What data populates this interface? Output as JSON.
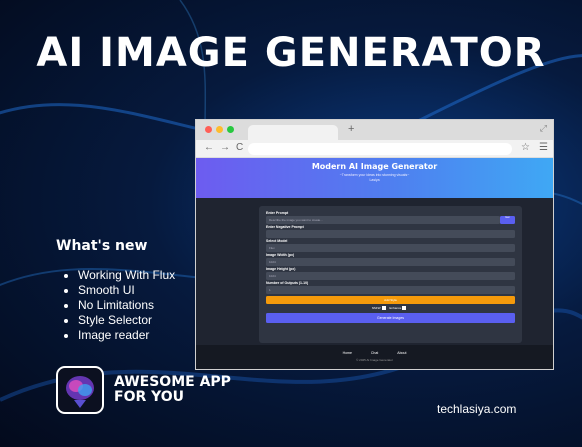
{
  "headline": "AI IMAGE GENERATOR",
  "whats_new": {
    "title": "What's new",
    "items": [
      "Working With Flux",
      "Smooth UI",
      "No Limitations",
      "Style Selector",
      "Image reader"
    ]
  },
  "app_badge": {
    "line1": "AWESOME APP",
    "line2": "FOR YOU"
  },
  "site": "techlasiya.com",
  "browser": {
    "plus": "+",
    "back": "←",
    "forward": "→",
    "reload": "C",
    "star": "☆",
    "menu": "☰",
    "page": {
      "title": "Modern AI Image Generator",
      "subtitle": "~Transform your ideas into stunning visuals~",
      "author": "Lasiya",
      "labels": {
        "prompt": "Enter Prompt",
        "negative": "Enter Negative Prompt",
        "model": "Select Model",
        "width": "Image Width (px)",
        "height": "Image Height (px)",
        "outputs": "Number of Outputs (1-10)"
      },
      "prompt_placeholder": "Describe the image you want to create...",
      "gen_small": "Gen",
      "model_value": "Flux",
      "width_value": "1024",
      "height_value": "1024",
      "outputs_value": "1",
      "orange_button": "Add Style",
      "check1": "NSFW",
      "check2": "Enhance",
      "generate": "Generate Images",
      "footer_links": [
        "Home",
        "Chat",
        "About"
      ],
      "copyright": "© 2025 AI Image Generator"
    }
  }
}
